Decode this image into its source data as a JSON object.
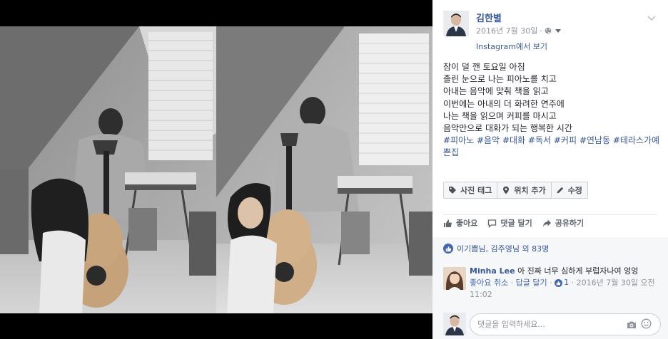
{
  "post": {
    "author": "김한별",
    "date": "2016년 7월 30일",
    "meta_separator": "·",
    "via_link": "Instagram에서 보기",
    "body_lines": [
      "잠이 덜 깬 토요일 아침",
      "졸린 눈으로 나는 피아노를 치고",
      "아내는 음악에 맞춰 책을 읽고",
      "이번에는 아내의 더 화려한 연주에",
      "나는 책을 읽으며 커피를 마시고",
      "음악만으로 대화가 되는 행복한 시간"
    ],
    "hashtags": [
      "#피아노",
      "#음악",
      "#대화",
      "#독서",
      "#커피",
      "#연남동",
      "#테라스가예쁜집"
    ]
  },
  "tag_bar": {
    "photo_tag": "사진 태그",
    "add_location": "위치 추가",
    "edit": "수정"
  },
  "actions": {
    "like": "좋아요",
    "comment": "댓글 달기",
    "share": "공유하기"
  },
  "likes_summary": "이기쁨님, 김주영님 외 83명",
  "comment": {
    "author": "Minha Lee",
    "text": "아 진짜 너무 심하게 부럽자나여 엉엉",
    "unlike": "좋아요 취소",
    "reply": "답글 달기",
    "like_count": "1",
    "timestamp_line1": "2016년 7월 30일 오전",
    "timestamp_line2": "11:02",
    "sep": "·"
  },
  "reply_box": {
    "placeholder": "댓글을 입력하세요..."
  },
  "icons": {
    "globe": "globe-icon",
    "chevron": "chevron-down-icon",
    "tag": "tag-icon",
    "location": "location-pin-icon",
    "edit": "pencil-icon",
    "like": "thumbs-up-icon",
    "comment": "comment-bubble-icon",
    "share": "share-arrow-icon",
    "camera": "camera-icon",
    "emoji": "emoji-icon"
  },
  "colors": {
    "link": "#365899",
    "accent": "#4267b2",
    "muted": "#90949c",
    "text": "#1d2129"
  }
}
